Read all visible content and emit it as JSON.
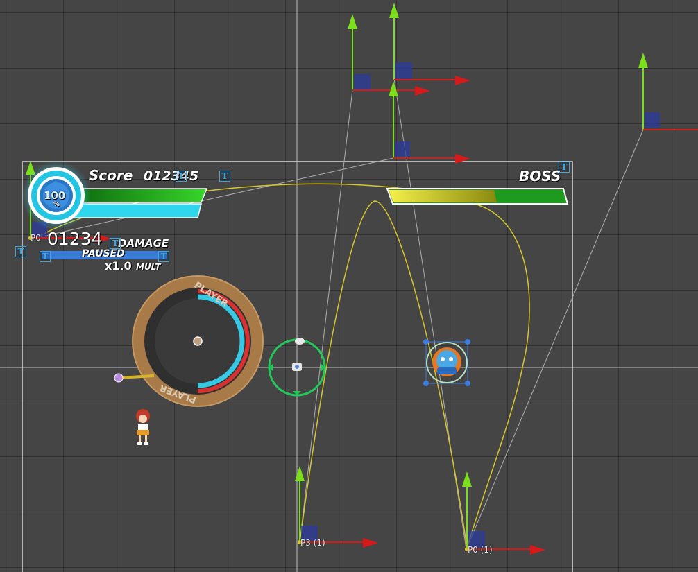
{
  "hud": {
    "health_percent_value": "100",
    "health_percent_unit": "%",
    "score_label": "Score",
    "score_value": "012345",
    "boss_label": "BOSS",
    "boss_health_fraction": 0.45,
    "damage_value": "01234",
    "damage_label": "DAMAGE",
    "paused_label": "PAUSED",
    "mult_value": "x1.0",
    "mult_label": "MULT",
    "player_ring_label_top": "PLAYER",
    "player_ring_label_bottom": "PLAYER"
  },
  "path_points": {
    "p0_label": "P0",
    "p3_label": "P3 (1)",
    "p0_1_label": "P0 (1)"
  },
  "icons": {
    "text_component": "T",
    "health_orb": "health-orb-icon",
    "boss_sprite": "boss-sprite-icon",
    "player_sprite": "player-character-icon",
    "drone": "drone-icon",
    "sword": "sword-icon"
  },
  "colors": {
    "scene_background": "#454545",
    "health_cyan": "#2fd6ee",
    "health_green": "#22bb22",
    "boss_yellow": "#d4d020",
    "boss_green": "#1e9a1e",
    "ring_brown": "#a87a47",
    "ring_cyan": "#35c9e4",
    "ring_red": "#d63232",
    "gizmo_green": "#7be01b",
    "gizmo_red": "#d61a1a",
    "gizmo_blue": "#2b3b9c",
    "path_yellow": "#d8c82a"
  }
}
